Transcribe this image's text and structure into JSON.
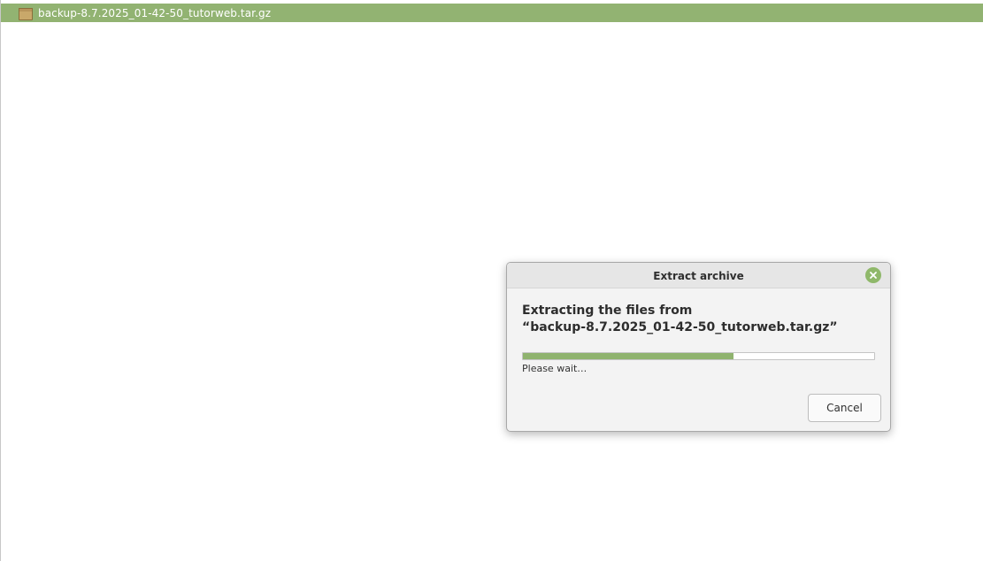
{
  "file_list": {
    "selected_file": {
      "name": "backup-8.7.2025_01-42-50_tutorweb.tar.gz",
      "icon": "archive-icon"
    }
  },
  "dialog": {
    "title": "Extract archive",
    "heading_line1": "Extracting the files from",
    "heading_line2": "“backup-8.7.2025_01-42-50_tutorweb.tar.gz”",
    "progress_fraction": 0.6,
    "status_text": "Please wait…",
    "cancel_label": "Cancel",
    "close_icon": "close-icon"
  },
  "colors": {
    "accent": "#92b372",
    "progress_fill": "#8fb36e",
    "close_button": "#8fb86a"
  }
}
